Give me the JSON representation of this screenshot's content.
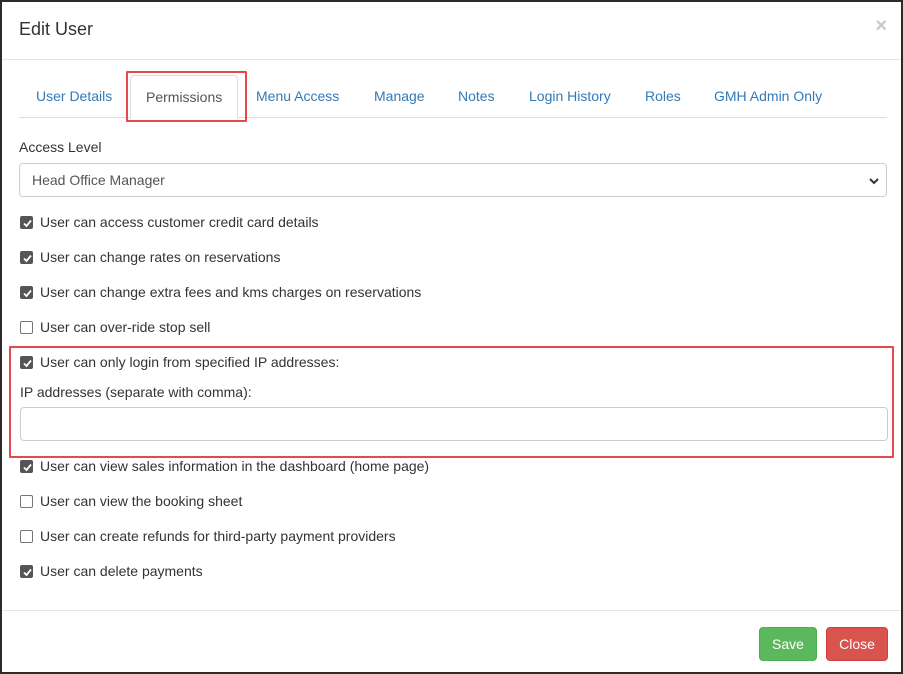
{
  "dialog": {
    "title": "Edit User",
    "close_glyph": "×"
  },
  "tabs": [
    {
      "label": "User Details",
      "active": false
    },
    {
      "label": "Permissions",
      "active": true
    },
    {
      "label": "Menu Access",
      "active": false
    },
    {
      "label": "Manage",
      "active": false
    },
    {
      "label": "Notes",
      "active": false
    },
    {
      "label": "Login History",
      "active": false
    },
    {
      "label": "Roles",
      "active": false
    },
    {
      "label": "GMH Admin Only",
      "active": false
    }
  ],
  "access_level": {
    "label": "Access Level",
    "selected": "Head Office Manager"
  },
  "permissions": [
    {
      "label": "User can access customer credit card details",
      "checked": true
    },
    {
      "label": "User can change rates on reservations",
      "checked": true
    },
    {
      "label": "User can change extra fees and kms charges on reservations",
      "checked": true
    },
    {
      "label": "User can over-ride stop sell",
      "checked": false
    },
    {
      "label": "User can only login from specified IP addresses:",
      "checked": true
    },
    {
      "label": "User can view sales information in the dashboard (home page)",
      "checked": true
    },
    {
      "label": "User can view the booking sheet",
      "checked": false
    },
    {
      "label": "User can create refunds for third-party payment providers",
      "checked": false
    },
    {
      "label": "User can delete payments",
      "checked": true
    }
  ],
  "ip_field": {
    "label": "IP addresses (separate with comma):",
    "value": ""
  },
  "footer": {
    "save_label": "Save",
    "close_label": "Close"
  },
  "colors": {
    "link": "#337ab7",
    "highlight": "#e5484d",
    "save": "#5cb85c",
    "close": "#d9534f"
  }
}
